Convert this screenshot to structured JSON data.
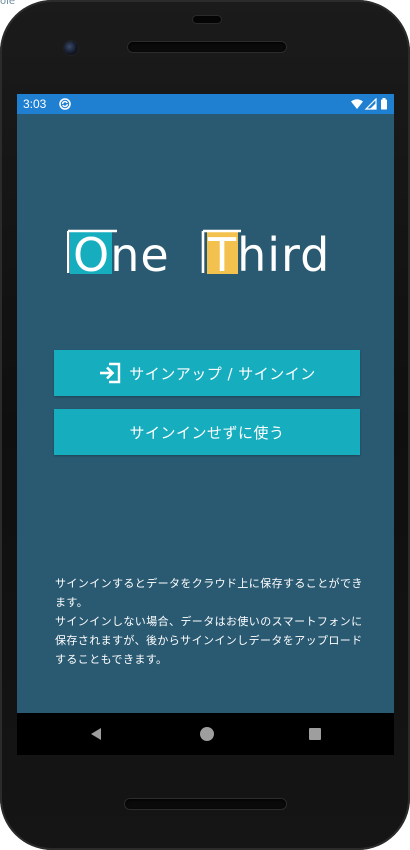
{
  "page_corner_text": "ole",
  "status_bar": {
    "time": "3:03"
  },
  "logo": {
    "part1": "One",
    "part2": "Third"
  },
  "buttons": {
    "signup_label": "サインアップ / サインイン",
    "guest_label": "サインインせずに使う"
  },
  "info": {
    "paragraph1": "サインインするとデータをクラウド上に保存することができます。",
    "paragraph2": "サインインしない場合、データはお使いのスマートフォンに保存されますが、後からサインインしデータをアップロードすることもできます。"
  },
  "colors": {
    "status_bar": "#1f7fd1",
    "screen_background": "#2a5a72",
    "button": "#16aebf",
    "logo_accent_teal": "#16aebf",
    "logo_accent_yellow": "#f2c14e"
  },
  "icons": {
    "status_left": "sync-icon",
    "status_right": [
      "wifi-icon",
      "signal-icon",
      "battery-icon"
    ],
    "signup_button": "login-arrow-icon",
    "nav": [
      "back-icon",
      "home-icon",
      "recents-icon"
    ]
  }
}
